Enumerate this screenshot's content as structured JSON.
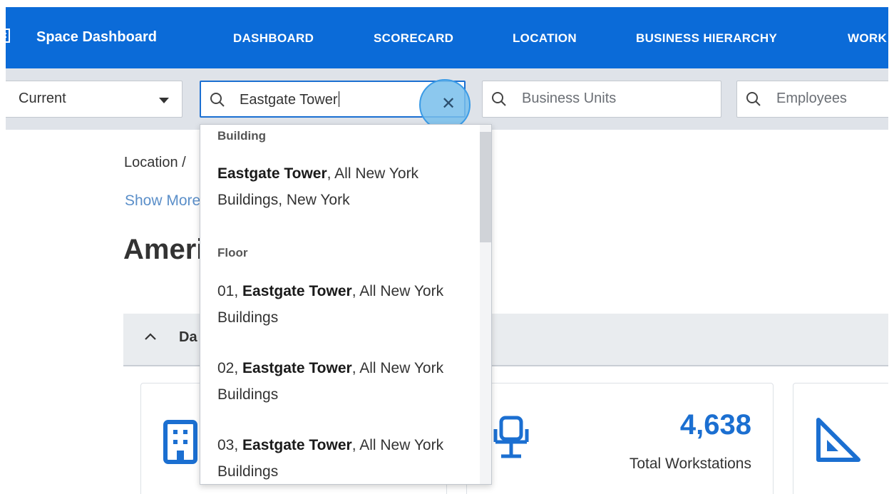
{
  "nav": {
    "app_title": "Space Dashboard",
    "items": [
      "DASHBOARD",
      "SCORECARD",
      "LOCATION",
      "BUSINESS HIERARCHY",
      "WORK"
    ]
  },
  "filters": {
    "period_value": "Current",
    "location_search_value": "Eastgate Tower",
    "business_units_placeholder": "Business Units",
    "employees_placeholder": "Employees"
  },
  "dropdown": {
    "groups": [
      {
        "label": "Building",
        "items": [
          {
            "match": "Eastgate Tower",
            "prefix": "",
            "rest_line1": ", All New York",
            "line2": "Buildings, New York"
          }
        ]
      },
      {
        "label": "Floor",
        "items": [
          {
            "prefix": "01, ",
            "match": "Eastgate Tower",
            "rest_line1": ", All New York",
            "line2": "Buildings"
          },
          {
            "prefix": "02, ",
            "match": "Eastgate Tower",
            "rest_line1": ", All New York",
            "line2": "Buildings"
          },
          {
            "prefix": "03, ",
            "match": "Eastgate Tower",
            "rest_line1": ", All New York",
            "line2": "Buildings"
          }
        ]
      }
    ]
  },
  "page": {
    "breadcrumb": "Location /",
    "show_more": "Show More",
    "title": "Ameri",
    "section_label": "Da"
  },
  "stats": {
    "workstations_value": "4,638",
    "workstations_label": "Total Workstations"
  },
  "colors": {
    "nav_bg": "#0b6bd8",
    "accent": "#1b6fd1",
    "filter_bg": "#dfe3e9"
  }
}
